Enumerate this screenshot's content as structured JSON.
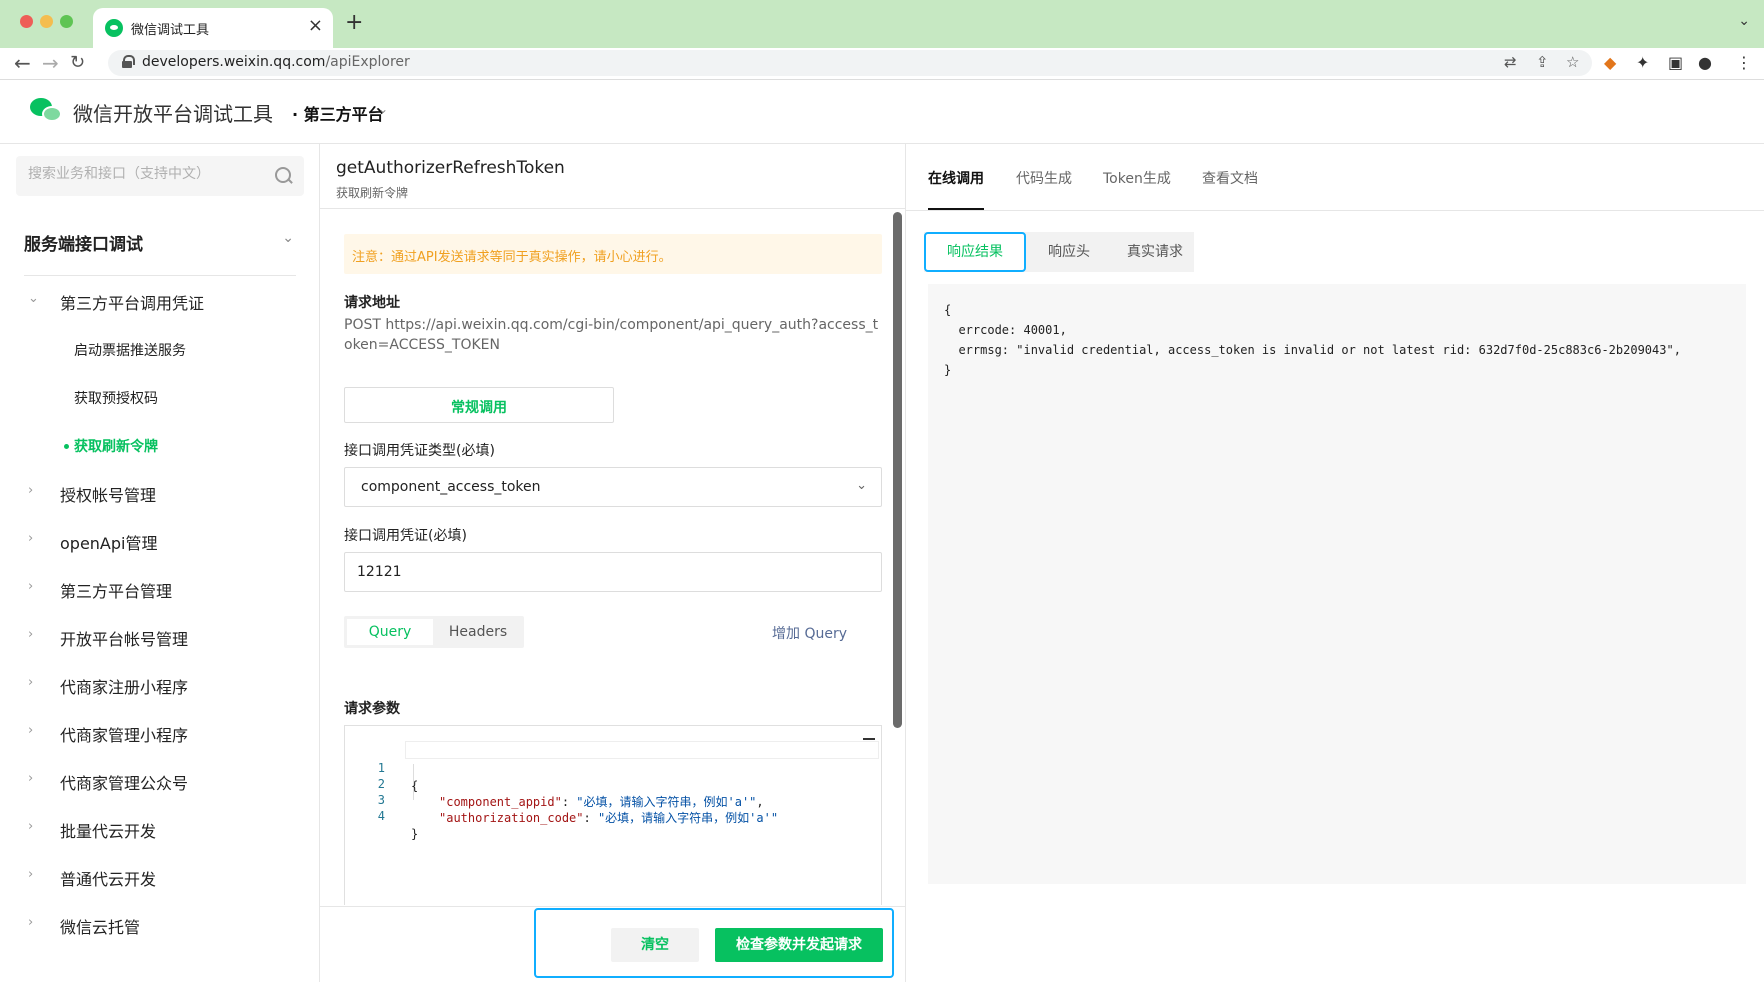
{
  "browser": {
    "tab_title": "微信调试工具",
    "url_host": "developers.weixin.qq.com",
    "url_path": "/apiExplorer"
  },
  "header": {
    "title": "微信开放平台调试工具",
    "platform": "· 第三方平台"
  },
  "sidebar": {
    "search_placeholder": "搜索业务和接口（支持中文）",
    "section_title": "服务端接口调试",
    "group_title": "第三方平台调用凭证",
    "children": [
      "启动票据推送服务",
      "获取预授权码",
      "获取刷新令牌"
    ],
    "active_child": "获取刷新令牌",
    "items": [
      "授权帐号管理",
      "openApi管理",
      "第三方平台管理",
      "开放平台帐号管理",
      "代商家注册小程序",
      "代商家管理小程序",
      "代商家管理公众号",
      "批量代云开发",
      "普通代云开发",
      "微信云托管"
    ]
  },
  "api": {
    "name": "getAuthorizerRefreshToken",
    "desc": "获取刷新令牌",
    "notice": "注意：通过API发送请求等同于真实操作，请小心进行。",
    "request_url_label": "请求地址",
    "request_url": "POST https://api.weixin.qq.com/cgi-bin/component/api_query_auth?access_token=ACCESS_TOKEN",
    "call_mode": "常规调用",
    "cred_type_label": "接口调用凭证类型(必填)",
    "cred_type_value": "component_access_token",
    "cred_label": "接口调用凭证(必填)",
    "cred_value": "12121",
    "tabs": [
      "Query",
      "Headers"
    ],
    "add_query": "增加 Query",
    "params_label": "请求参数",
    "code_lines": [
      {
        "n": "1",
        "text": "{"
      },
      {
        "n": "2",
        "key": "\"component_appid\"",
        "sep": ": ",
        "val": "\"必填，请输入字符串，例如'a'\"",
        "tail": ","
      },
      {
        "n": "3",
        "key": "\"authorization_code\"",
        "sep": ": ",
        "val": "\"必填，请输入字符串，例如'a'\"",
        "tail": ""
      },
      {
        "n": "4",
        "text": "}"
      }
    ],
    "clear_label": "清空",
    "send_label": "检查参数并发起请求"
  },
  "right": {
    "tabs": [
      "在线调用",
      "代码生成",
      "Token生成",
      "查看文档"
    ],
    "resp_tabs": [
      "响应结果",
      "响应头",
      "真实请求"
    ],
    "response": "{\n  errcode: 40001,\n  errmsg: \"invalid credential, access_token is invalid or not latest rid: 632d7f0d-25c883c6-2b209043\",\n}"
  },
  "colors": {
    "brand_green": "#07c160",
    "highlight_blue": "#10aeff",
    "notice_orange": "#f0a020"
  }
}
